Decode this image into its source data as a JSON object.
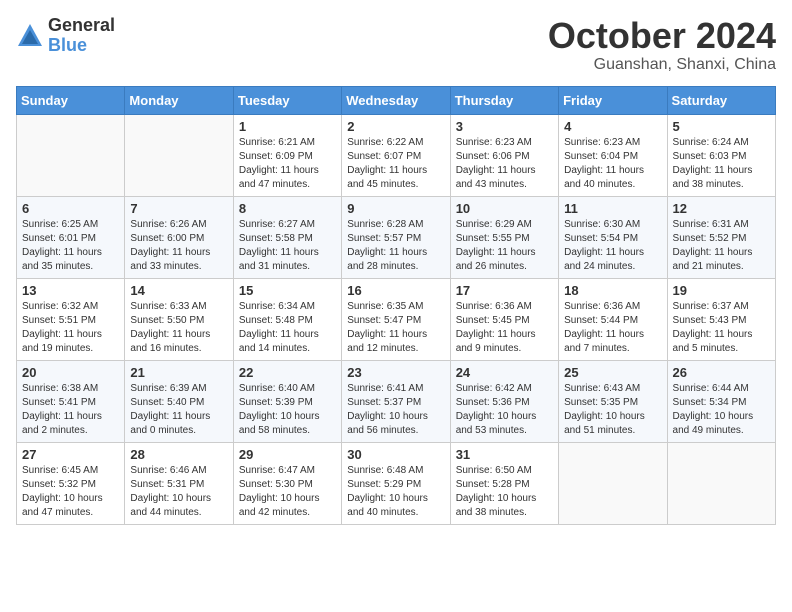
{
  "logo": {
    "general": "General",
    "blue": "Blue"
  },
  "title": "October 2024",
  "location": "Guanshan, Shanxi, China",
  "weekdays": [
    "Sunday",
    "Monday",
    "Tuesday",
    "Wednesday",
    "Thursday",
    "Friday",
    "Saturday"
  ],
  "weeks": [
    [
      {
        "day": "",
        "info": ""
      },
      {
        "day": "",
        "info": ""
      },
      {
        "day": "1",
        "info": "Sunrise: 6:21 AM\nSunset: 6:09 PM\nDaylight: 11 hours and 47 minutes."
      },
      {
        "day": "2",
        "info": "Sunrise: 6:22 AM\nSunset: 6:07 PM\nDaylight: 11 hours and 45 minutes."
      },
      {
        "day": "3",
        "info": "Sunrise: 6:23 AM\nSunset: 6:06 PM\nDaylight: 11 hours and 43 minutes."
      },
      {
        "day": "4",
        "info": "Sunrise: 6:23 AM\nSunset: 6:04 PM\nDaylight: 11 hours and 40 minutes."
      },
      {
        "day": "5",
        "info": "Sunrise: 6:24 AM\nSunset: 6:03 PM\nDaylight: 11 hours and 38 minutes."
      }
    ],
    [
      {
        "day": "6",
        "info": "Sunrise: 6:25 AM\nSunset: 6:01 PM\nDaylight: 11 hours and 35 minutes."
      },
      {
        "day": "7",
        "info": "Sunrise: 6:26 AM\nSunset: 6:00 PM\nDaylight: 11 hours and 33 minutes."
      },
      {
        "day": "8",
        "info": "Sunrise: 6:27 AM\nSunset: 5:58 PM\nDaylight: 11 hours and 31 minutes."
      },
      {
        "day": "9",
        "info": "Sunrise: 6:28 AM\nSunset: 5:57 PM\nDaylight: 11 hours and 28 minutes."
      },
      {
        "day": "10",
        "info": "Sunrise: 6:29 AM\nSunset: 5:55 PM\nDaylight: 11 hours and 26 minutes."
      },
      {
        "day": "11",
        "info": "Sunrise: 6:30 AM\nSunset: 5:54 PM\nDaylight: 11 hours and 24 minutes."
      },
      {
        "day": "12",
        "info": "Sunrise: 6:31 AM\nSunset: 5:52 PM\nDaylight: 11 hours and 21 minutes."
      }
    ],
    [
      {
        "day": "13",
        "info": "Sunrise: 6:32 AM\nSunset: 5:51 PM\nDaylight: 11 hours and 19 minutes."
      },
      {
        "day": "14",
        "info": "Sunrise: 6:33 AM\nSunset: 5:50 PM\nDaylight: 11 hours and 16 minutes."
      },
      {
        "day": "15",
        "info": "Sunrise: 6:34 AM\nSunset: 5:48 PM\nDaylight: 11 hours and 14 minutes."
      },
      {
        "day": "16",
        "info": "Sunrise: 6:35 AM\nSunset: 5:47 PM\nDaylight: 11 hours and 12 minutes."
      },
      {
        "day": "17",
        "info": "Sunrise: 6:36 AM\nSunset: 5:45 PM\nDaylight: 11 hours and 9 minutes."
      },
      {
        "day": "18",
        "info": "Sunrise: 6:36 AM\nSunset: 5:44 PM\nDaylight: 11 hours and 7 minutes."
      },
      {
        "day": "19",
        "info": "Sunrise: 6:37 AM\nSunset: 5:43 PM\nDaylight: 11 hours and 5 minutes."
      }
    ],
    [
      {
        "day": "20",
        "info": "Sunrise: 6:38 AM\nSunset: 5:41 PM\nDaylight: 11 hours and 2 minutes."
      },
      {
        "day": "21",
        "info": "Sunrise: 6:39 AM\nSunset: 5:40 PM\nDaylight: 11 hours and 0 minutes."
      },
      {
        "day": "22",
        "info": "Sunrise: 6:40 AM\nSunset: 5:39 PM\nDaylight: 10 hours and 58 minutes."
      },
      {
        "day": "23",
        "info": "Sunrise: 6:41 AM\nSunset: 5:37 PM\nDaylight: 10 hours and 56 minutes."
      },
      {
        "day": "24",
        "info": "Sunrise: 6:42 AM\nSunset: 5:36 PM\nDaylight: 10 hours and 53 minutes."
      },
      {
        "day": "25",
        "info": "Sunrise: 6:43 AM\nSunset: 5:35 PM\nDaylight: 10 hours and 51 minutes."
      },
      {
        "day": "26",
        "info": "Sunrise: 6:44 AM\nSunset: 5:34 PM\nDaylight: 10 hours and 49 minutes."
      }
    ],
    [
      {
        "day": "27",
        "info": "Sunrise: 6:45 AM\nSunset: 5:32 PM\nDaylight: 10 hours and 47 minutes."
      },
      {
        "day": "28",
        "info": "Sunrise: 6:46 AM\nSunset: 5:31 PM\nDaylight: 10 hours and 44 minutes."
      },
      {
        "day": "29",
        "info": "Sunrise: 6:47 AM\nSunset: 5:30 PM\nDaylight: 10 hours and 42 minutes."
      },
      {
        "day": "30",
        "info": "Sunrise: 6:48 AM\nSunset: 5:29 PM\nDaylight: 10 hours and 40 minutes."
      },
      {
        "day": "31",
        "info": "Sunrise: 6:50 AM\nSunset: 5:28 PM\nDaylight: 10 hours and 38 minutes."
      },
      {
        "day": "",
        "info": ""
      },
      {
        "day": "",
        "info": ""
      }
    ]
  ]
}
